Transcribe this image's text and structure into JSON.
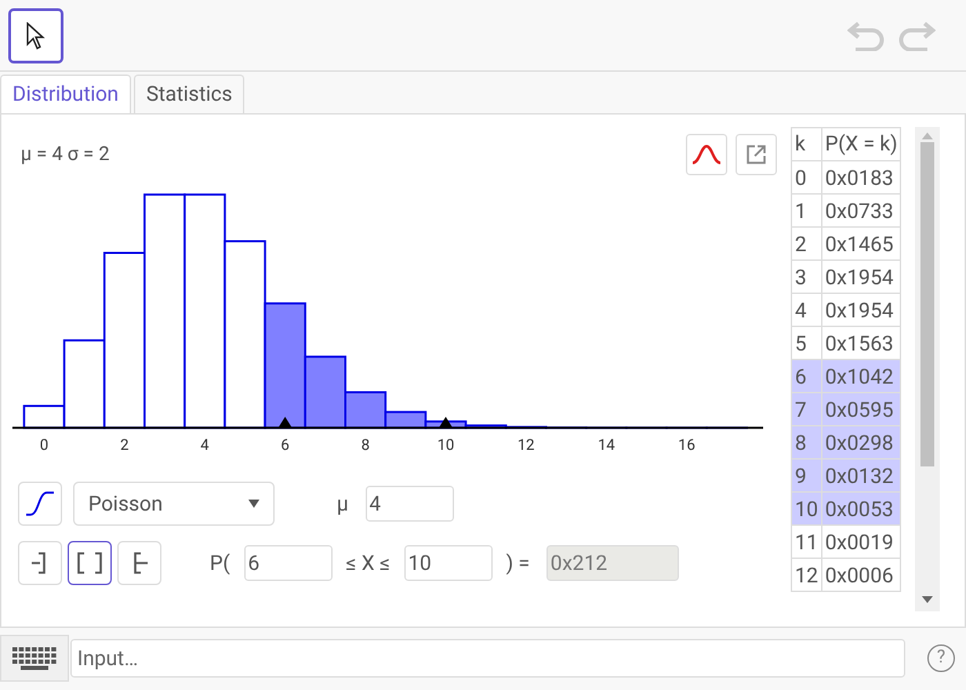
{
  "move_tool": {
    "selected": true
  },
  "tabs": [
    {
      "label": "Distribution",
      "selected": true
    },
    {
      "label": "Statistics",
      "selected": false
    }
  ],
  "distribution": {
    "summary": "μ = 4 σ = 2",
    "axis_labels": [
      "0",
      "2",
      "4",
      "6",
      "8",
      "10",
      "12",
      "14",
      "16"
    ],
    "type": "Poisson",
    "parameter_label": "μ",
    "parameter_value": "4",
    "interval_modes": [
      {
        "kind": "left",
        "selected": false
      },
      {
        "kind": "two",
        "selected": true
      },
      {
        "kind": "right",
        "selected": false
      }
    ],
    "probability": {
      "prefix": "P(",
      "low": "6",
      "middle": "≤ X ≤",
      "high": "10",
      "suffix": ") =",
      "result": "0x212"
    }
  },
  "table": {
    "columns": [
      "k",
      "P(X = k)"
    ],
    "rows": [
      {
        "cells": [
          "0",
          "0x0183"
        ],
        "selected": false
      },
      {
        "cells": [
          "1",
          "0x0733"
        ],
        "selected": false
      },
      {
        "cells": [
          "2",
          "0x1465"
        ],
        "selected": false
      },
      {
        "cells": [
          "3",
          "0x1954"
        ],
        "selected": false
      },
      {
        "cells": [
          "4",
          "0x1954"
        ],
        "selected": false
      },
      {
        "cells": [
          "5",
          "0x1563"
        ],
        "selected": false
      },
      {
        "cells": [
          "6",
          "0x1042"
        ],
        "selected": true
      },
      {
        "cells": [
          "7",
          "0x0595"
        ],
        "selected": true
      },
      {
        "cells": [
          "8",
          "0x0298"
        ],
        "selected": true
      },
      {
        "cells": [
          "9",
          "0x0132"
        ],
        "selected": true
      },
      {
        "cells": [
          "10",
          "0x0053"
        ],
        "selected": true
      },
      {
        "cells": [
          "11",
          "0x0019"
        ],
        "selected": false
      },
      {
        "cells": [
          "12",
          "0x0006"
        ],
        "selected": false
      }
    ]
  },
  "input_bar": {
    "placeholder": "Input…",
    "help": "?"
  }
}
